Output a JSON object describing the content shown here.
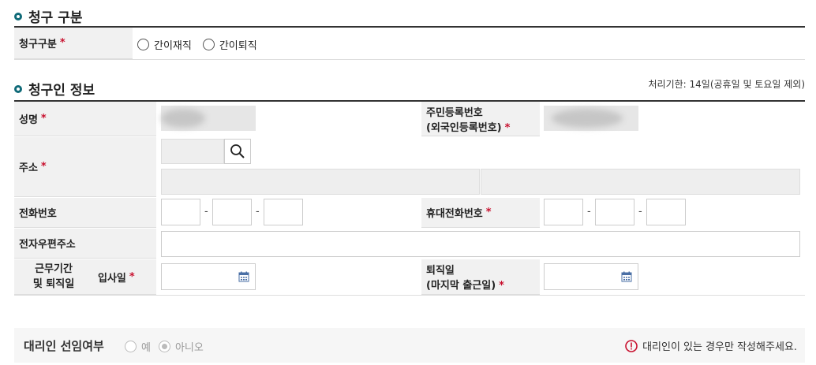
{
  "sections": {
    "claim_type_title": "청구 구분",
    "claimant_title": "청구인 정보",
    "deadline_note": "처리기한: 14일(공휴일 및 토요일 제외)"
  },
  "claim_type": {
    "label": "청구구분",
    "required_mark": "*",
    "options": [
      "간이재직",
      "간이퇴직"
    ]
  },
  "fields": {
    "name_label": "성명",
    "rrn_label_line1": "주민등록번호",
    "rrn_label_line2": "(외국인등록번호)",
    "address_label": "주소",
    "phone_label": "전화번호",
    "mobile_label": "휴대전화번호",
    "email_label": "전자우편주소",
    "period_label_line1": "근무기간",
    "period_label_line2": "및 퇴직일",
    "join_label": "입사일",
    "retire_label_line1": "퇴직일",
    "retire_label_line2": "(마지막 출근일)",
    "required_mark": "*",
    "dash": "-"
  },
  "agent": {
    "label": "대리인 선임여부",
    "options": [
      "예",
      "아니오"
    ],
    "selected": "아니오",
    "notice": "대리인이 있는 경우만 작성해주세요."
  },
  "colors": {
    "accent": "#0f6a78",
    "required": "#c8102e",
    "notice": "#c8102e",
    "label_bg": "#f1f1f1",
    "calendar": "#4a6fa5"
  }
}
